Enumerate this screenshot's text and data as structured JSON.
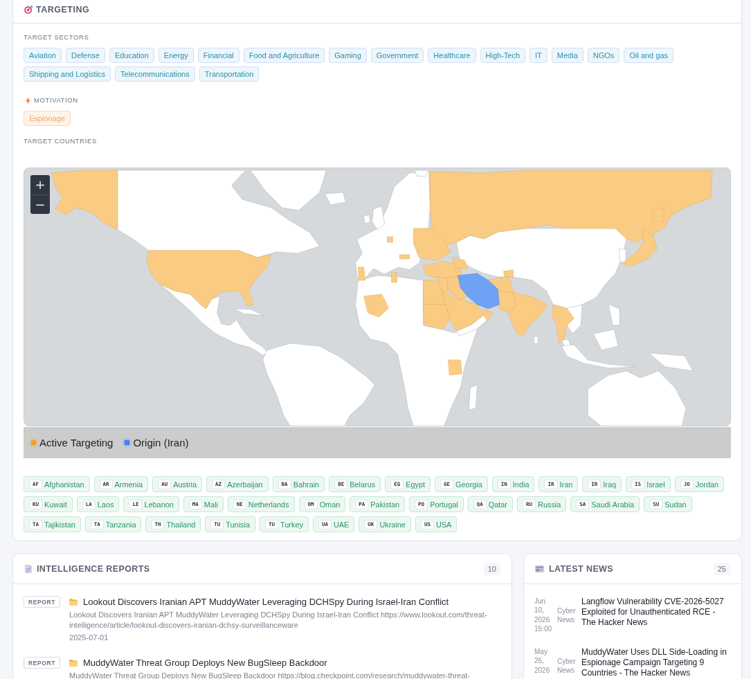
{
  "targeting": {
    "title": "TARGETING",
    "sectors_label": "TARGET SECTORS",
    "sectors": [
      "Aviation",
      "Defense",
      "Education",
      "Energy",
      "Financial",
      "Food and Agriculture",
      "Gaming",
      "Government",
      "Healthcare",
      "High-Tech",
      "IT",
      "Media",
      "NGOs",
      "Oil and gas",
      "Shipping and Logistics",
      "Telecommunications",
      "Transportation"
    ],
    "motivation_label": "MOTIVATION",
    "motivations": [
      "Espionage"
    ],
    "countries_label": "TARGET COUNTRIES",
    "map": {
      "zoom_in": "+",
      "zoom_out": "−",
      "legend": [
        {
          "label": "Active Targeting",
          "color": "#f6a21e"
        },
        {
          "label": "Origin (Iran)",
          "color": "#3f82f0"
        }
      ]
    },
    "countries": [
      {
        "code": "AF",
        "name": "Afghanistan"
      },
      {
        "code": "AR",
        "name": "Armenia"
      },
      {
        "code": "AU",
        "name": "Austria"
      },
      {
        "code": "AZ",
        "name": "Azerbaijan"
      },
      {
        "code": "BA",
        "name": "Bahrain"
      },
      {
        "code": "BE",
        "name": "Belarus"
      },
      {
        "code": "EG",
        "name": "Egypt"
      },
      {
        "code": "GE",
        "name": "Georgia"
      },
      {
        "code": "IN",
        "name": "India"
      },
      {
        "code": "IR",
        "name": "Iran"
      },
      {
        "code": "IR",
        "name": "Iraq"
      },
      {
        "code": "IS",
        "name": "Israel"
      },
      {
        "code": "JO",
        "name": "Jordan"
      },
      {
        "code": "KU",
        "name": "Kuwait"
      },
      {
        "code": "LA",
        "name": "Laos"
      },
      {
        "code": "LE",
        "name": "Lebanon"
      },
      {
        "code": "MA",
        "name": "Mali"
      },
      {
        "code": "NE",
        "name": "Netherlands"
      },
      {
        "code": "OM",
        "name": "Oman"
      },
      {
        "code": "PA",
        "name": "Pakistan"
      },
      {
        "code": "PO",
        "name": "Portugal"
      },
      {
        "code": "QA",
        "name": "Qatar"
      },
      {
        "code": "RU",
        "name": "Russia"
      },
      {
        "code": "SA",
        "name": "Saudi Arabia"
      },
      {
        "code": "SU",
        "name": "Sudan"
      },
      {
        "code": "TA",
        "name": "Tajikistan"
      },
      {
        "code": "TA",
        "name": "Tanzania"
      },
      {
        "code": "TH",
        "name": "Thailand"
      },
      {
        "code": "TU",
        "name": "Tunisia"
      },
      {
        "code": "TU",
        "name": "Turkey"
      },
      {
        "code": "UA",
        "name": "UAE"
      },
      {
        "code": "UK",
        "name": "Ukraine"
      },
      {
        "code": "US",
        "name": "USA"
      }
    ]
  },
  "intelligence_reports": {
    "title": "INTELLIGENCE REPORTS",
    "count": "10",
    "items": [
      {
        "badge": "REPORT",
        "title": "Lookout Discovers Iranian APT MuddyWater Leveraging DCHSpy During Israel-Iran Conflict",
        "description": "Lookout Discovers Iranian APT MuddyWater Leveraging DCHSpy During Israel-Iran Conflict https://www.lookout.com/threat-intelligence/article/lookout-discovers-iranian-dchsy-surveillanceware",
        "date": "2025-07-01"
      },
      {
        "badge": "REPORT",
        "title": "MuddyWater Threat Group Deploys New BugSleep Backdoor",
        "description": "MuddyWater Threat Group Deploys New BugSleep Backdoor https://blog.checkpoint.com/research/muddywater-threat-"
      }
    ]
  },
  "latest_news": {
    "title": "LATEST NEWS",
    "count": "25",
    "items": [
      {
        "date": "Jun 10, 2026 15:00",
        "source": "Cyber News",
        "title": "Langflow Vulnerability CVE-2026-5027 Exploited for Unauthenticated RCE - The Hacker News"
      },
      {
        "date": "May 26, 2026",
        "source": "Cyber News",
        "title": "MuddyWater Uses DLL Side-Loading in Espionage Campaign Targeting 9 Countries - The Hacker News"
      }
    ]
  }
}
